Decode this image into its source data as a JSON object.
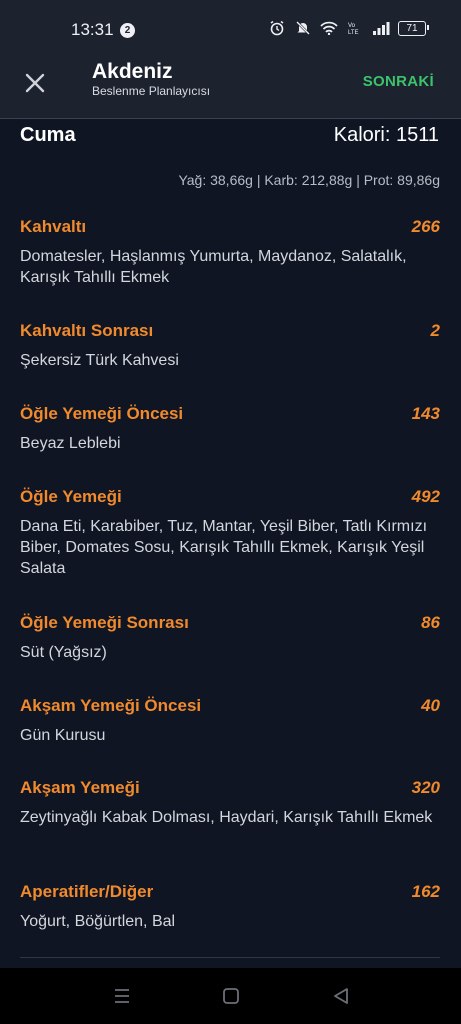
{
  "status_bar": {
    "time": "13:31",
    "notification_count": "2",
    "battery": "71"
  },
  "app_bar": {
    "title": "Akdeniz",
    "subtitle": "Beslenme Planlayıcısı",
    "next_label": "SONRAKİ"
  },
  "summary": {
    "day": "Cuma",
    "calories": "Kalori: 1511",
    "macros": "Yağ: 38,66g | Karb: 212,88g | Prot: 89,86g"
  },
  "meals": [
    {
      "name": "Kahvaltı",
      "calories": "266",
      "items": "Domatesler, Haşlanmış Yumurta, Maydanoz, Salatalık, Karışık Tahıllı Ekmek"
    },
    {
      "name": "Kahvaltı Sonrası",
      "calories": "2",
      "items": "Şekersiz Türk Kahvesi"
    },
    {
      "name": "Öğle Yemeği Öncesi",
      "calories": "143",
      "items": "Beyaz Leblebi"
    },
    {
      "name": "Öğle Yemeği",
      "calories": "492",
      "items": "Dana Eti, Karabiber, Tuz, Mantar, Yeşil Biber, Tatlı Kırmızı Biber, Domates Sosu, Karışık Tahıllı Ekmek, Karışık Yeşil Salata"
    },
    {
      "name": "Öğle Yemeği Sonrası",
      "calories": "86",
      "items": "Süt (Yağsız)"
    },
    {
      "name": "Akşam Yemeği Öncesi",
      "calories": "40",
      "items": "Gün Kurusu"
    },
    {
      "name": "Akşam Yemeği",
      "calories": "320",
      "items": "Zeytinyağlı Kabak Dolması, Haydari, Karışık Tahıllı Ekmek"
    },
    {
      "name": "Aperatifler/Diğer",
      "calories": "162",
      "items": "Yoğurt, Böğürtlen, Bal"
    }
  ],
  "colors": {
    "accent": "#f08a2c",
    "next": "#3cc36c",
    "background": "#0f1523",
    "bar": "#1c222e"
  },
  "icons": [
    "close-icon",
    "alarm-icon",
    "mute-icon",
    "wifi-icon",
    "volte-icon",
    "signal-icon",
    "battery-icon",
    "recents-icon",
    "home-icon",
    "back-icon"
  ]
}
